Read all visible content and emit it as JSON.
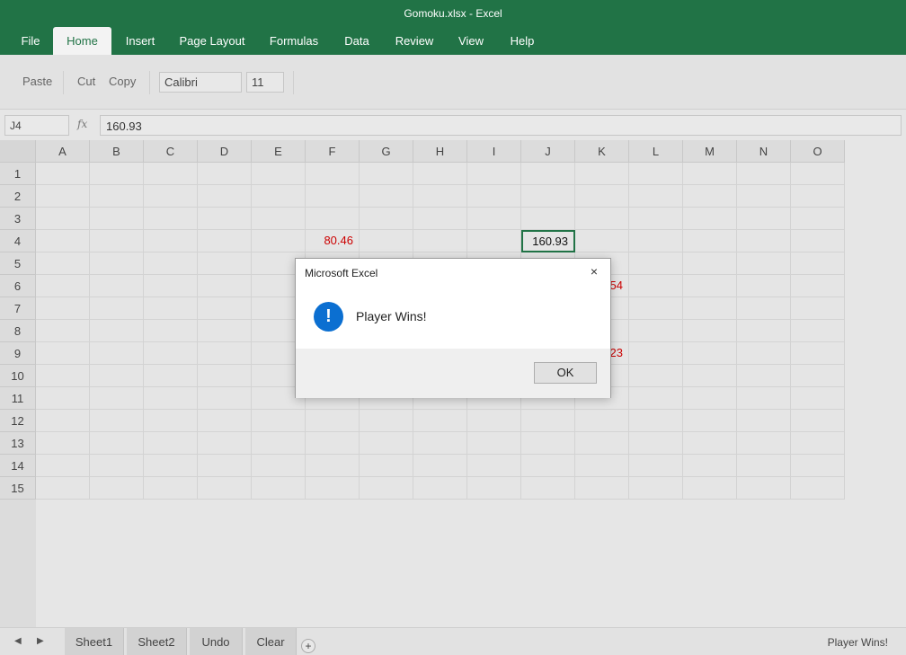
{
  "window": {
    "title": "Gomoku.xlsx - Excel"
  },
  "ribbon_tabs": [
    "File",
    "Home",
    "Insert",
    "Page Layout",
    "Formulas",
    "Data",
    "Review",
    "View",
    "Help"
  ],
  "active_tab": "Home",
  "ribbon": {
    "paste": "Paste",
    "cut": "Cut",
    "copy": "Copy",
    "font": "Calibri",
    "font_size": "11"
  },
  "formula_bar": {
    "name_box": "J4",
    "fx": "fx",
    "value": "160.93"
  },
  "columns": [
    "A",
    "B",
    "C",
    "D",
    "E",
    "F",
    "G",
    "H",
    "I",
    "J",
    "K",
    "L",
    "M",
    "N",
    "O"
  ],
  "rows": [
    "1",
    "2",
    "3",
    "4",
    "5",
    "6",
    "7",
    "8",
    "9",
    "10",
    "11",
    "12",
    "13",
    "14",
    "15"
  ],
  "cells": {
    "F4": "80.46",
    "J4": "160.93",
    "K6": "54",
    "K9": "23"
  },
  "selected_cell": "J4",
  "cell_color": "#cc0000",
  "accent_color": "#217346",
  "dialog": {
    "title": "Microsoft Excel",
    "close": "×",
    "icon": "info-icon",
    "message": "Player Wins!",
    "ok_label": "OK"
  },
  "sheet_tabs": [
    "Sheet1",
    "Sheet2",
    "Undo",
    "Clear"
  ],
  "add_sheet": "+",
  "status_text": "Player Wins!"
}
